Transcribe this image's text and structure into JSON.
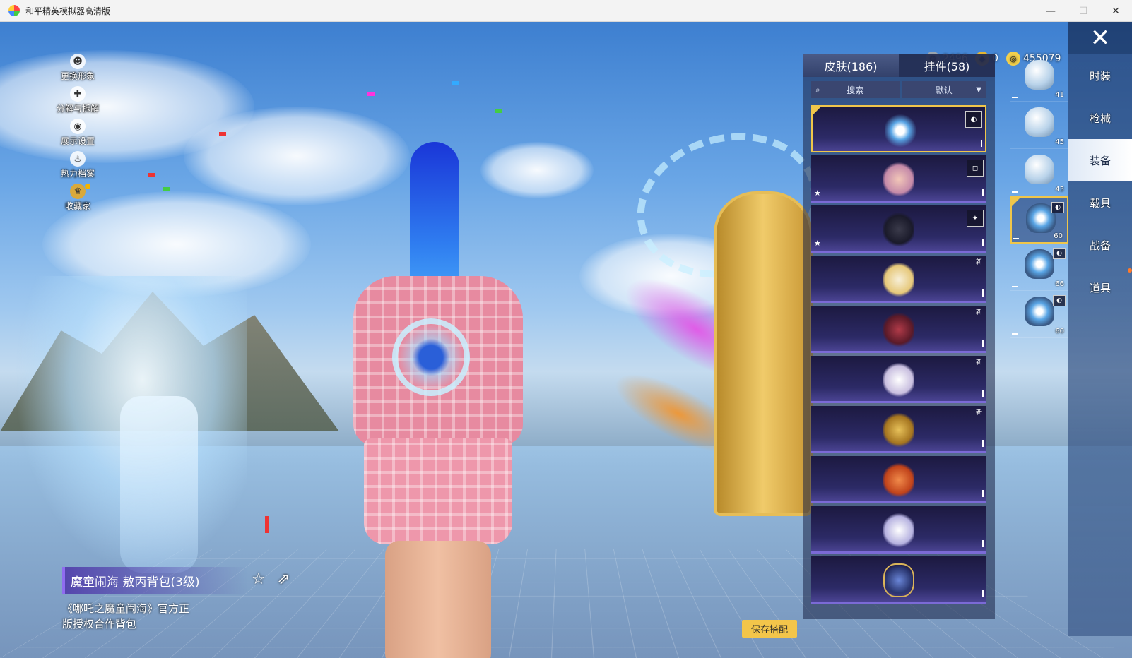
{
  "window": {
    "title": "和平精英模拟器高清版",
    "controls": [
      "—",
      "☐",
      "✕"
    ]
  },
  "left_menu": [
    {
      "label": "更换形象",
      "icon": "avatar-icon",
      "glyph": "☻"
    },
    {
      "label": "分解与拆解",
      "icon": "puzzle-icon",
      "glyph": "✚"
    },
    {
      "label": "展示设置",
      "icon": "eye-icon",
      "glyph": "◉"
    },
    {
      "label": "热力档案",
      "icon": "flame-icon",
      "glyph": "♨"
    },
    {
      "label": "收藏家",
      "icon": "collector-badge-icon",
      "glyph": "♛"
    }
  ],
  "currency": [
    {
      "icon": "medal-icon",
      "value": "2496",
      "color": "#9aa4ad"
    },
    {
      "icon": "gold-badge-icon",
      "value": "0",
      "color": "#e5b530"
    },
    {
      "icon": "coin-icon",
      "value": "455079",
      "color": "#f2d04c"
    }
  ],
  "close_glyph": "✕",
  "panel": {
    "tabs": [
      {
        "label": "皮肤(186)",
        "active": true
      },
      {
        "label": "挂件(58)",
        "active": false
      }
    ],
    "search_placeholder": "搜索",
    "sort_value": "默认",
    "items": [
      {
        "art_color": "#5aa6e6",
        "selected": true,
        "corner": "◐"
      },
      {
        "art_color": "#f2c7b8",
        "star": "★",
        "corner": "◻"
      },
      {
        "art_color": "#2a2a3a",
        "star": "★",
        "corner": "✦"
      },
      {
        "art_color": "#f7efd8",
        "new": "新"
      },
      {
        "art_color": "#8a2a38",
        "new": "新"
      },
      {
        "art_color": "#ece8f4",
        "new": "新"
      },
      {
        "art_color": "#c99b3a",
        "new": "新"
      },
      {
        "art_color": "#e0602a"
      },
      {
        "art_color": "#f4f4fa"
      },
      {
        "art_color": "#2a3670"
      }
    ]
  },
  "thumbs": [
    {
      "level": "41"
    },
    {
      "level": "45"
    },
    {
      "level": "43"
    },
    {
      "level": "60",
      "selected": true
    },
    {
      "level": "66"
    },
    {
      "level": "60"
    }
  ],
  "categories": [
    {
      "label": "时装",
      "active": false
    },
    {
      "label": "枪械",
      "active": false
    },
    {
      "label": "装备",
      "active": true
    },
    {
      "label": "载具",
      "active": false
    },
    {
      "label": "战备",
      "active": false
    },
    {
      "label": "道具",
      "active": false
    }
  ],
  "item_info": {
    "name": "魔童闹海 敖丙背包(3级)",
    "description": "《哪吒之魔童闹海》官方正版授权合作背包"
  },
  "save_button": "保存搭配"
}
